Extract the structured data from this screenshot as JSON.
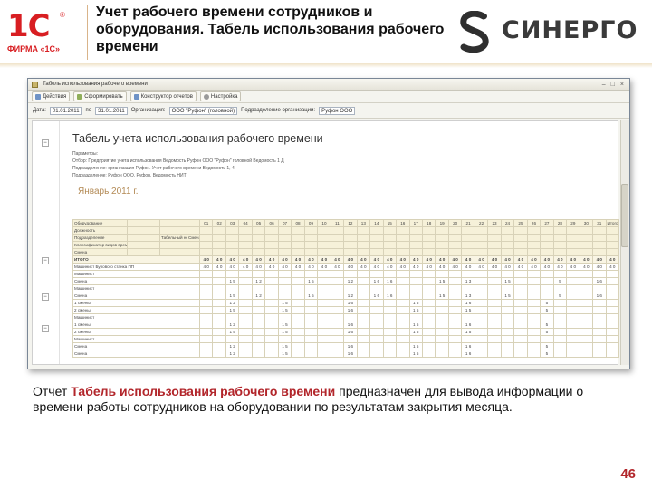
{
  "header": {
    "logo_1c_mark": "1С",
    "logo_1c_caption": "ФИРМА «1С»",
    "title": "Учет рабочего времени сотрудников и оборудования. Табель использования рабочего времени",
    "partner_logo": "СИНЕРГО"
  },
  "window": {
    "title": "Табель использования рабочего времени",
    "controls": [
      "–",
      "□",
      "×"
    ]
  },
  "toolbar": {
    "buttons": [
      {
        "label": "Действия",
        "icon": "actions-icon"
      },
      {
        "label": "Сформировать",
        "icon": "generate-icon"
      },
      {
        "label": "Конструктор отчетов",
        "icon": "designer-icon"
      },
      {
        "label": "Настройка",
        "icon": "gear-icon"
      }
    ]
  },
  "params": {
    "period_label": "Дата:",
    "period_from": "01.01.2011",
    "period_to_label": "по",
    "period_to": "31.01.2011",
    "org_label": "Организация:",
    "org_value": "ООО \"Руфон\" (головной)",
    "sched_label": "Подразделение организации:",
    "sched_value": "Руфон ООО"
  },
  "report": {
    "title": "Табель учета использования рабочего времени",
    "filters": [
      "Параметры:",
      "Отбор:        Предприятие учета использования Ведомость Руфон ООО \"Руфон\" головной Ведомость 1 Д",
      "                   Подразделение: организация Руфон. Учет рабочего времени Ведомость 1, 4",
      "                   Подразделение: Руфон ООО, Руфон. Ведомость НИТ"
    ],
    "period": "Январь 2011 г.",
    "days": [
      "01",
      "02",
      "03",
      "04",
      "05",
      "06",
      "07",
      "08",
      "09",
      "10",
      "11",
      "12",
      "13",
      "14",
      "15",
      "16",
      "17",
      "18",
      "19",
      "20",
      "21",
      "22",
      "23",
      "24",
      "25",
      "26",
      "27",
      "28",
      "29",
      "30",
      "31",
      "Итого"
    ],
    "header_rows": [
      [
        "Оборудование",
        "",
        "",
        ""
      ],
      [
        "Должность",
        "",
        "",
        ""
      ],
      [
        "Подразделение",
        "",
        "Табельный номер",
        "Смена"
      ],
      [
        "Классификатор видов времени",
        "",
        "",
        ""
      ],
      [
        "Смена",
        "",
        "",
        ""
      ]
    ],
    "rows": [
      {
        "label": "ИТОГО",
        "type": "tot",
        "cells": [
          "4 0",
          "4 0",
          "4 0",
          "4 0",
          "4 0",
          "4 0",
          "4 0",
          "4 0",
          "4 0",
          "4 0",
          "4 0",
          "4 0",
          "4 0",
          "4 0",
          "4 0",
          "4 0",
          "4 0",
          "4 0",
          "4 0",
          "4 0",
          "4 0",
          "4 0",
          "4 0",
          "4 0",
          "4 0",
          "4 0",
          "4 0",
          "4 0",
          "4 0",
          "4 0",
          "4 0",
          "4 0"
        ]
      },
      {
        "label": "Машинист Бурового станка ПП",
        "type": "",
        "cells": [
          "4 0",
          "4 0",
          "4 0",
          "4 0",
          "4 0",
          "4 0",
          "4 0",
          "4 0",
          "4 0",
          "4 0",
          "4 0",
          "4 0",
          "4 0",
          "4 0",
          "4 0",
          "4 0",
          "4 0",
          "4 0",
          "4 0",
          "4 0",
          "4 0",
          "4 0",
          "4 0",
          "4 0",
          "4 0",
          "4 0",
          "4 0",
          "4 0",
          "4 0",
          "4 0",
          "4 0",
          "4 0"
        ]
      },
      {
        "label": "Машинист",
        "type": "",
        "cells": [
          "",
          "",
          "",
          "",
          "",
          "",
          "",
          "",
          "",
          "",
          "",
          "",
          "",
          "",
          "",
          "",
          "",
          "",
          "",
          "",
          "",
          "",
          "",
          "",
          "",
          "",
          "",
          "",
          "",
          "",
          "",
          ""
        ]
      },
      {
        "label": "Смена",
        "type": "",
        "cells": [
          "",
          "",
          "1 5",
          "",
          "1 2",
          "",
          "",
          "",
          "1 5",
          "",
          "",
          "1 2",
          "",
          "1 6",
          "1 6",
          "",
          "",
          "",
          "1 5",
          "",
          "1 3",
          "",
          "",
          "1 5",
          "",
          "",
          "",
          "5",
          "",
          "",
          "1 6",
          ""
        ]
      },
      {
        "label": "Машинист",
        "type": "",
        "cells": [
          "",
          "",
          "",
          "",
          "",
          "",
          "",
          "",
          "",
          "",
          "",
          "",
          "",
          "",
          "",
          "",
          "",
          "",
          "",
          "",
          "",
          "",
          "",
          "",
          "",
          "",
          "",
          "",
          "",
          "",
          "",
          ""
        ]
      },
      {
        "label": "Смена",
        "type": "",
        "cells": [
          "",
          "",
          "1 5",
          "",
          "1 2",
          "",
          "",
          "",
          "1 5",
          "",
          "",
          "1 2",
          "",
          "1 6",
          "1 6",
          "",
          "",
          "",
          "1 5",
          "",
          "1 3",
          "",
          "",
          "1 5",
          "",
          "",
          "",
          "5",
          "",
          "",
          "1 6",
          ""
        ]
      },
      {
        "label": "1 смены",
        "type": "",
        "cells": [
          "",
          "",
          "1 2",
          "",
          "",
          "",
          "1 5",
          "",
          "",
          "",
          "",
          "1 6",
          "",
          "",
          "",
          "",
          "1 5",
          "",
          "",
          "",
          "1 6",
          "",
          "",
          "",
          "",
          "",
          "5",
          "",
          "",
          "",
          "",
          ""
        ]
      },
      {
        "label": "2 смены",
        "type": "",
        "cells": [
          "",
          "",
          "1 5",
          "",
          "",
          "",
          "1 5",
          "",
          "",
          "",
          "",
          "1 6",
          "",
          "",
          "",
          "",
          "1 5",
          "",
          "",
          "",
          "1 5",
          "",
          "",
          "",
          "",
          "",
          "5",
          "",
          "",
          "",
          "",
          ""
        ]
      },
      {
        "label": "Машинист",
        "type": "",
        "cells": [
          "",
          "",
          "",
          "",
          "",
          "",
          "",
          "",
          "",
          "",
          "",
          "",
          "",
          "",
          "",
          "",
          "",
          "",
          "",
          "",
          "",
          "",
          "",
          "",
          "",
          "",
          "",
          "",
          "",
          "",
          "",
          ""
        ]
      },
      {
        "label": "1 смены",
        "type": "",
        "cells": [
          "",
          "",
          "1 2",
          "",
          "",
          "",
          "1 5",
          "",
          "",
          "",
          "",
          "1 6",
          "",
          "",
          "",
          "",
          "1 5",
          "",
          "",
          "",
          "1 6",
          "",
          "",
          "",
          "",
          "",
          "5",
          "",
          "",
          "",
          "",
          ""
        ]
      },
      {
        "label": "2 смены",
        "type": "",
        "cells": [
          "",
          "",
          "1 5",
          "",
          "",
          "",
          "1 5",
          "",
          "",
          "",
          "",
          "1 6",
          "",
          "",
          "",
          "",
          "1 5",
          "",
          "",
          "",
          "1 5",
          "",
          "",
          "",
          "",
          "",
          "5",
          "",
          "",
          "",
          "",
          ""
        ]
      },
      {
        "label": "Машинист",
        "type": "",
        "cells": [
          "",
          "",
          "",
          "",
          "",
          "",
          "",
          "",
          "",
          "",
          "",
          "",
          "",
          "",
          "",
          "",
          "",
          "",
          "",
          "",
          "",
          "",
          "",
          "",
          "",
          "",
          "",
          "",
          "",
          "",
          "",
          ""
        ]
      },
      {
        "label": "Смена",
        "type": "",
        "cells": [
          "",
          "",
          "1 2",
          "",
          "",
          "",
          "1 5",
          "",
          "",
          "",
          "",
          "1 6",
          "",
          "",
          "",
          "",
          "1 5",
          "",
          "",
          "",
          "1 6",
          "",
          "",
          "",
          "",
          "",
          "5",
          "",
          "",
          "",
          "",
          ""
        ]
      },
      {
        "label": "Смена",
        "type": "",
        "cells": [
          "",
          "",
          "1 2",
          "",
          "",
          "",
          "1 5",
          "",
          "",
          "",
          "",
          "1 6",
          "",
          "",
          "",
          "",
          "1 5",
          "",
          "",
          "",
          "1 6",
          "",
          "",
          "",
          "",
          "",
          "5",
          "",
          "",
          "",
          "",
          ""
        ]
      }
    ]
  },
  "description": {
    "prefix": "Отчет ",
    "highlight": "Табель использования рабочего времени",
    "rest": " предназначен для вывода информации о времени работы сотрудников на оборудовании по результатам закрытия месяца."
  },
  "page_number": "46",
  "colors": {
    "brand_red": "#d81e22",
    "highlight_red": "#b2262b",
    "period_gold": "#b38a55"
  }
}
